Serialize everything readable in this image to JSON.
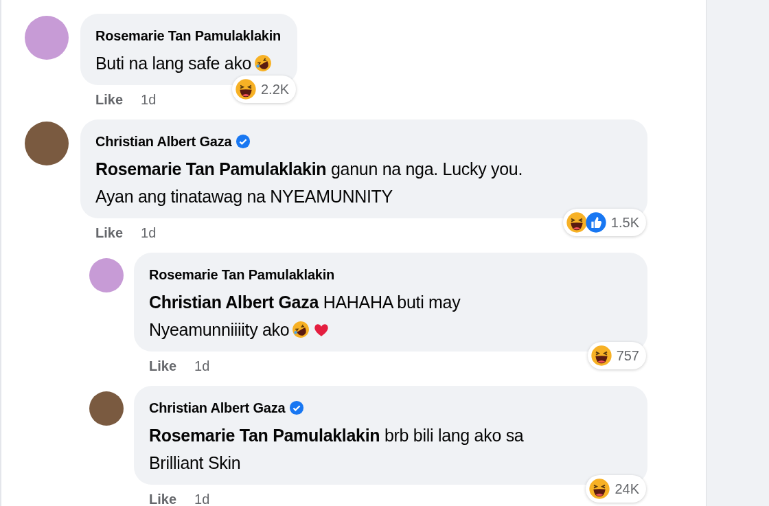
{
  "comments": [
    {
      "author": "Rosemarie Tan Pamulaklakin",
      "verified": false,
      "avatar": {
        "color": "#c79bd6"
      },
      "lines": [
        "Buti na lang safe ako"
      ],
      "inline_emojis": [
        {
          "kind": "rofl"
        }
      ],
      "reactions": [
        {
          "kind": "haha"
        }
      ],
      "reaction_count": "2.2K",
      "like": "Like",
      "time": "1d"
    },
    {
      "author": "Christian Albert Gaza",
      "verified": true,
      "avatar": {
        "color": "#7a5a40"
      },
      "lines": [
        "**Rosemarie Tan Pamulaklakin** ganun na nga. Lucky you.",
        "Ayan ang tinatawag na NYEAMUNNITY"
      ],
      "reactions": [
        {
          "kind": "haha"
        },
        {
          "kind": "like"
        }
      ],
      "reaction_count": "1.5K",
      "like": "Like",
      "time": "1d",
      "replies": [
        {
          "author": "Rosemarie Tan Pamulaklakin",
          "verified": false,
          "avatar": {
            "color": "#c79bd6"
          },
          "lines": [
            "**Christian Albert Gaza** HAHAHA buti may",
            "Nyeamunniiiity ako"
          ],
          "inline_emojis": [
            {
              "kind": "rofl"
            },
            {
              "kind": "heart"
            }
          ],
          "reactions": [
            {
              "kind": "haha"
            }
          ],
          "reaction_count": "757",
          "like": "Like",
          "time": "1d"
        },
        {
          "author": "Christian Albert Gaza",
          "verified": true,
          "avatar": {
            "color": "#7a5a40"
          },
          "lines": [
            "**Rosemarie Tan Pamulaklakin** brb bili lang ako sa",
            "Brilliant Skin"
          ],
          "reactions": [
            {
              "kind": "haha"
            }
          ],
          "reaction_count": "24K",
          "like": "Like",
          "time": "1d"
        }
      ]
    }
  ]
}
